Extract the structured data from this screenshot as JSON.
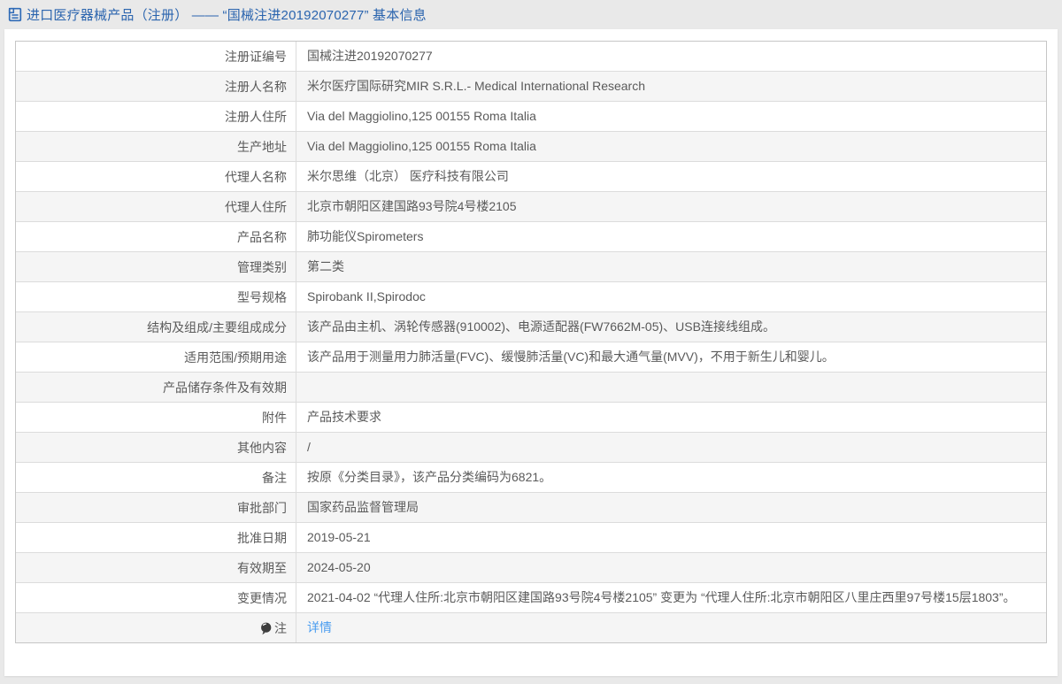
{
  "header": {
    "title": "进口医疗器械产品（注册） —— “国械注进20192070277” 基本信息"
  },
  "colors": {
    "page_background": "#e9e9e9",
    "panel_background": "#ffffff",
    "header_text": "#2a64ae",
    "table_text": "#5a5a5a",
    "row_alt_background": "#f5f5f5",
    "table_outer_border": "#c6c6c6",
    "table_inner_border": "#dcdcdc",
    "link": "#4b9df0",
    "header_icon": "#2f6bb7",
    "note_icon": "#3d3d3d"
  },
  "table": {
    "rows": [
      {
        "label": "注册证编号",
        "value": "国械注进20192070277"
      },
      {
        "label": "注册人名称",
        "value": "米尔医疗国际研究MIR S.R.L.- Medical International Research"
      },
      {
        "label": "注册人住所",
        "value": "Via del Maggiolino,125 00155 Roma Italia"
      },
      {
        "label": "生产地址",
        "value": "Via del Maggiolino,125 00155 Roma Italia"
      },
      {
        "label": "代理人名称",
        "value": "米尔思维（北京） 医疗科技有限公司"
      },
      {
        "label": "代理人住所",
        "value": "北京市朝阳区建国路93号院4号楼2105"
      },
      {
        "label": "产品名称",
        "value": "肺功能仪Spirometers"
      },
      {
        "label": "管理类别",
        "value": "第二类"
      },
      {
        "label": "型号规格",
        "value": "Spirobank II,Spirodoc"
      },
      {
        "label": "结构及组成/主要组成成分",
        "value": "该产品由主机、涡轮传感器(910002)、电源适配器(FW7662M-05)、USB连接线组成。"
      },
      {
        "label": "适用范围/预期用途",
        "value": "该产品用于测量用力肺活量(FVC)、缓慢肺活量(VC)和最大通气量(MVV)，不用于新生儿和婴儿。"
      },
      {
        "label": "产品储存条件及有效期",
        "value": ""
      },
      {
        "label": "附件",
        "value": "产品技术要求"
      },
      {
        "label": "其他内容",
        "value": "/"
      },
      {
        "label": "备注",
        "value": "按原《分类目录》，该产品分类编码为6821。"
      },
      {
        "label": "审批部门",
        "value": "国家药品监督管理局"
      },
      {
        "label": "批准日期",
        "value": "2019-05-21"
      },
      {
        "label": "有效期至",
        "value": "2024-05-20"
      },
      {
        "label": "变更情况",
        "value": "2021-04-02 “代理人住所:北京市朝阳区建国路93号院4号楼2105” 变更为 “代理人住所:北京市朝阳区八里庄西里97号楼15层1803”。"
      },
      {
        "label": "注",
        "label_icon": "note-icon",
        "value": "详情",
        "value_is_link": true
      }
    ]
  }
}
